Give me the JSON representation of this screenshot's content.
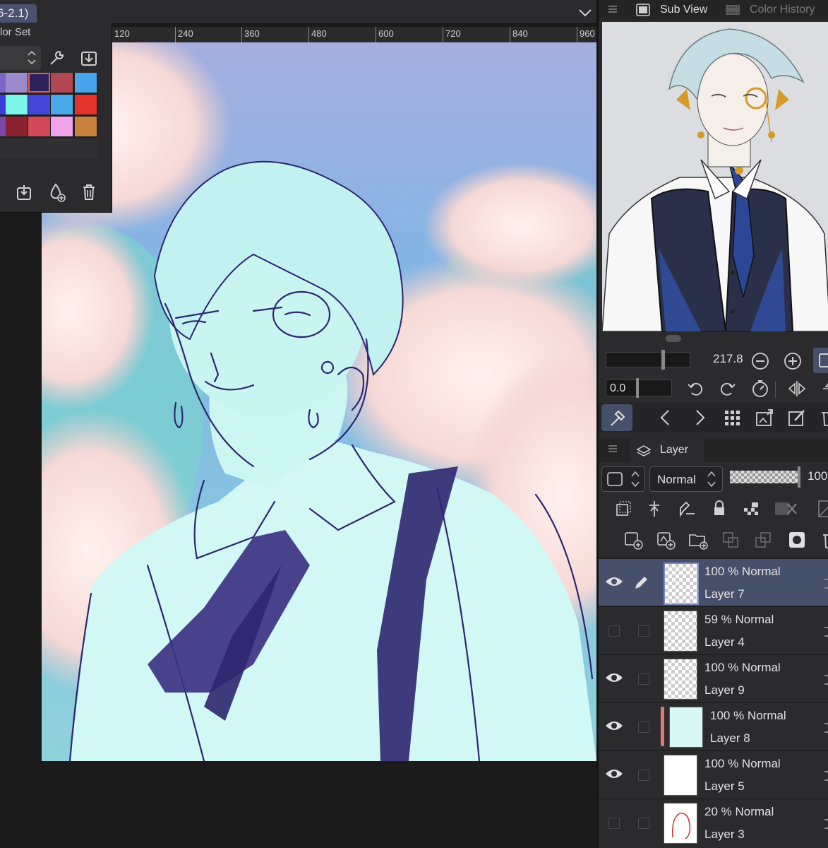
{
  "document": {
    "tab_label": "6-2.1)"
  },
  "ruler": {
    "ticks": [
      "120",
      "240",
      "360",
      "480",
      "600",
      "720",
      "840",
      "960"
    ]
  },
  "color_set": {
    "title": "lor Set",
    "swatches": [
      "#7c67c7",
      "#9b8acc",
      "#2e225c",
      "#b24652",
      "#4aa4ea",
      "#3c3cdc",
      "#7cf4e6",
      "#4545da",
      "#48a8e8",
      "#e5322a",
      "#7a48a8",
      "#8a2232",
      "#d34858",
      "#f0a2ec",
      "#c9823c"
    ],
    "selected_index": 2
  },
  "right_panel": {
    "tabs": {
      "sub_view": "Sub View",
      "color_history": "Color History"
    },
    "navigator": {
      "zoom": "217.8",
      "rotation": "0.0"
    },
    "layer_panel": {
      "title": "Layer",
      "blend_mode": "Normal",
      "opacity": "100",
      "layers": [
        {
          "opacity_mode": "100 %  Normal",
          "name": "Layer 7",
          "visible": true,
          "selected": true
        },
        {
          "opacity_mode": "59 %  Normal",
          "name": "Layer 4",
          "visible": false,
          "selected": false
        },
        {
          "opacity_mode": "100 %  Normal",
          "name": "Layer 9",
          "visible": true,
          "selected": false
        },
        {
          "opacity_mode": "100 %  Normal",
          "name": "Layer 8",
          "visible": true,
          "selected": false
        },
        {
          "opacity_mode": "100 %  Normal",
          "name": "Layer 5",
          "visible": true,
          "selected": false
        },
        {
          "opacity_mode": "20 %  Normal",
          "name": "Layer 3",
          "visible": false,
          "selected": false
        }
      ]
    }
  },
  "colors": {
    "accent": "#46506a",
    "panel": "#2b2b2d",
    "canvas_bg": "#1b1b1c"
  }
}
